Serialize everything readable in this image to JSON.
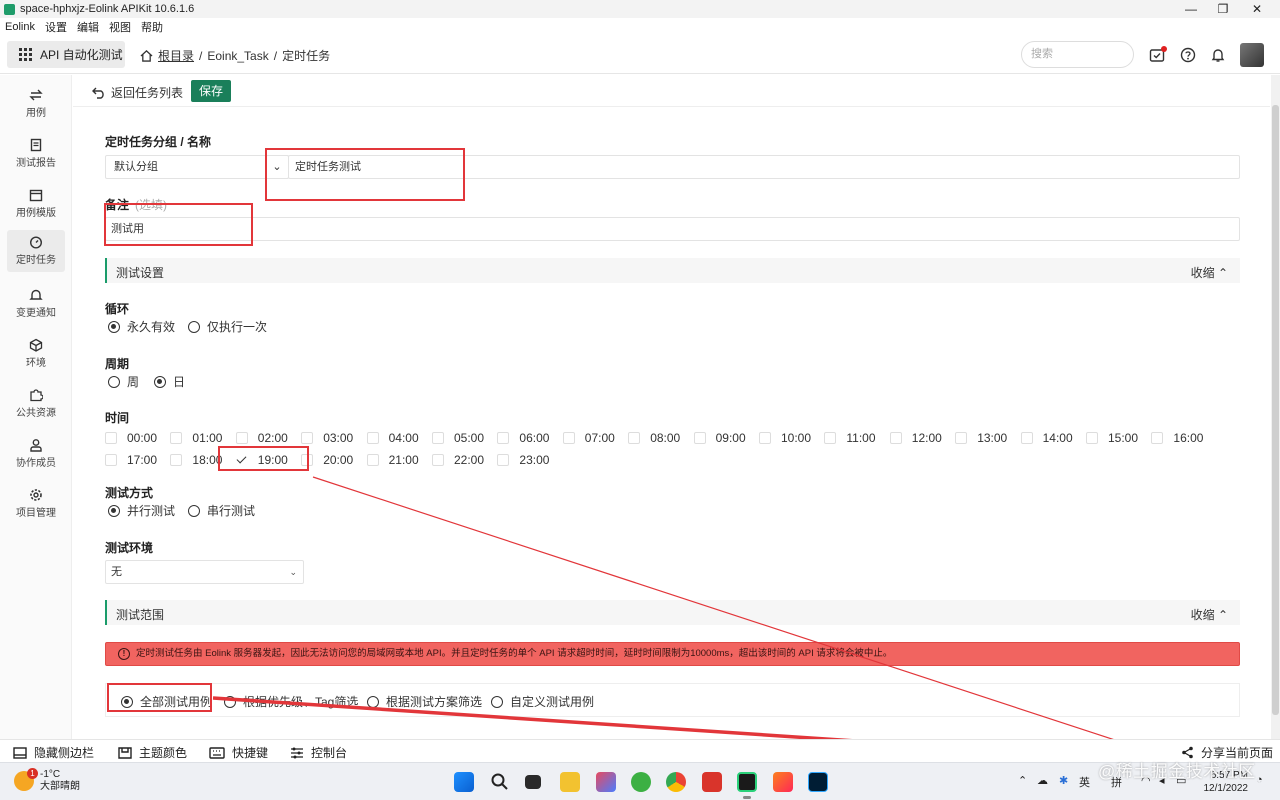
{
  "window": {
    "title": "space-hphxjz-Eolink APIKit 10.6.1.6",
    "controls": [
      "—",
      "❐",
      "✕"
    ]
  },
  "menu": [
    "Eolink",
    "设置",
    "编辑",
    "视图",
    "帮助"
  ],
  "header": {
    "module_label": "API 自动化测试",
    "breadcrumb": {
      "root": "根目录",
      "sep1": "/",
      "item1": "Eoink_Task",
      "sep2": "/",
      "item2": "定时任务"
    },
    "search_placeholder": "搜索"
  },
  "sidebar": {
    "items": [
      {
        "label": "用例",
        "icon": "swap-icon"
      },
      {
        "label": "测试报告",
        "icon": "report-icon"
      },
      {
        "label": "用例模版",
        "icon": "template-icon"
      },
      {
        "label": "定时任务",
        "icon": "timer-icon",
        "active": true
      },
      {
        "label": "变更通知",
        "icon": "bell-icon"
      },
      {
        "label": "环境",
        "icon": "cube-icon"
      },
      {
        "label": "公共资源",
        "icon": "puzzle-icon"
      },
      {
        "label": "协作成员",
        "icon": "user-icon"
      },
      {
        "label": "项目管理",
        "icon": "gear-icon"
      }
    ]
  },
  "toolbar": {
    "back_label": "返回任务列表",
    "save_label": "保存"
  },
  "form": {
    "group_name_label": "定时任务分组 / 名称",
    "group_value": "默认分组",
    "name_value": "定时任务测试",
    "remark_label": "备注",
    "remark_optional": "(选填)",
    "remark_value": "测试用",
    "settings_title": "测试设置",
    "collapse_label": "收缩 ⌃",
    "loop_label": "循环",
    "loop_options": [
      {
        "label": "永久有效",
        "checked": true
      },
      {
        "label": "仅执行一次",
        "checked": false
      }
    ],
    "period_label": "周期",
    "period_options": [
      {
        "label": "周",
        "checked": false
      },
      {
        "label": "日",
        "checked": true
      }
    ],
    "time_label": "时间",
    "times": [
      "00:00",
      "01:00",
      "02:00",
      "03:00",
      "04:00",
      "05:00",
      "06:00",
      "07:00",
      "08:00",
      "09:00",
      "10:00",
      "11:00",
      "12:00",
      "13:00",
      "14:00",
      "15:00",
      "16:00",
      "17:00",
      "18:00",
      "19:00",
      "20:00",
      "21:00",
      "22:00",
      "23:00"
    ],
    "checked_time": "19:00",
    "mode_label": "测试方式",
    "mode_options": [
      {
        "label": "并行测试",
        "checked": true
      },
      {
        "label": "串行测试",
        "checked": false
      }
    ],
    "env_label": "测试环境",
    "env_value": "无",
    "scope_title": "测试范围",
    "alert_icon": "!",
    "alert_text": "定时测试任务由 Eolink 服务器发起，因此无法访问您的局域网或本地 API。并且定时任务的单个 API 请求超时时间，延时时间限制为10000ms，超出该时间的 API 请求将会被中止。",
    "scope_options": [
      {
        "label": "全部测试用例",
        "checked": true
      },
      {
        "label": "根据优先级、Tag筛选",
        "checked": false
      },
      {
        "label": "根据测试方案筛选",
        "checked": false
      },
      {
        "label": "自定义测试用例",
        "checked": false
      }
    ]
  },
  "bottombar": {
    "hide_sidebar": "隐藏侧边栏",
    "theme": "主题颜色",
    "shortcuts": "快捷键",
    "console": "控制台",
    "share": "分享当前页面"
  },
  "taskbar": {
    "weather_temp": "-1°C",
    "weather_desc": "大部晴朗",
    "weather_badge": "1",
    "ime_lang": "英",
    "ime_mode": "拼",
    "time": "6:57 PM",
    "date": "12/1/2022"
  },
  "watermark": "@稀土掘金技术社区",
  "colors": {
    "accent": "#1a7f5a",
    "alert": "#f16460",
    "annotation": "#e2363a"
  }
}
